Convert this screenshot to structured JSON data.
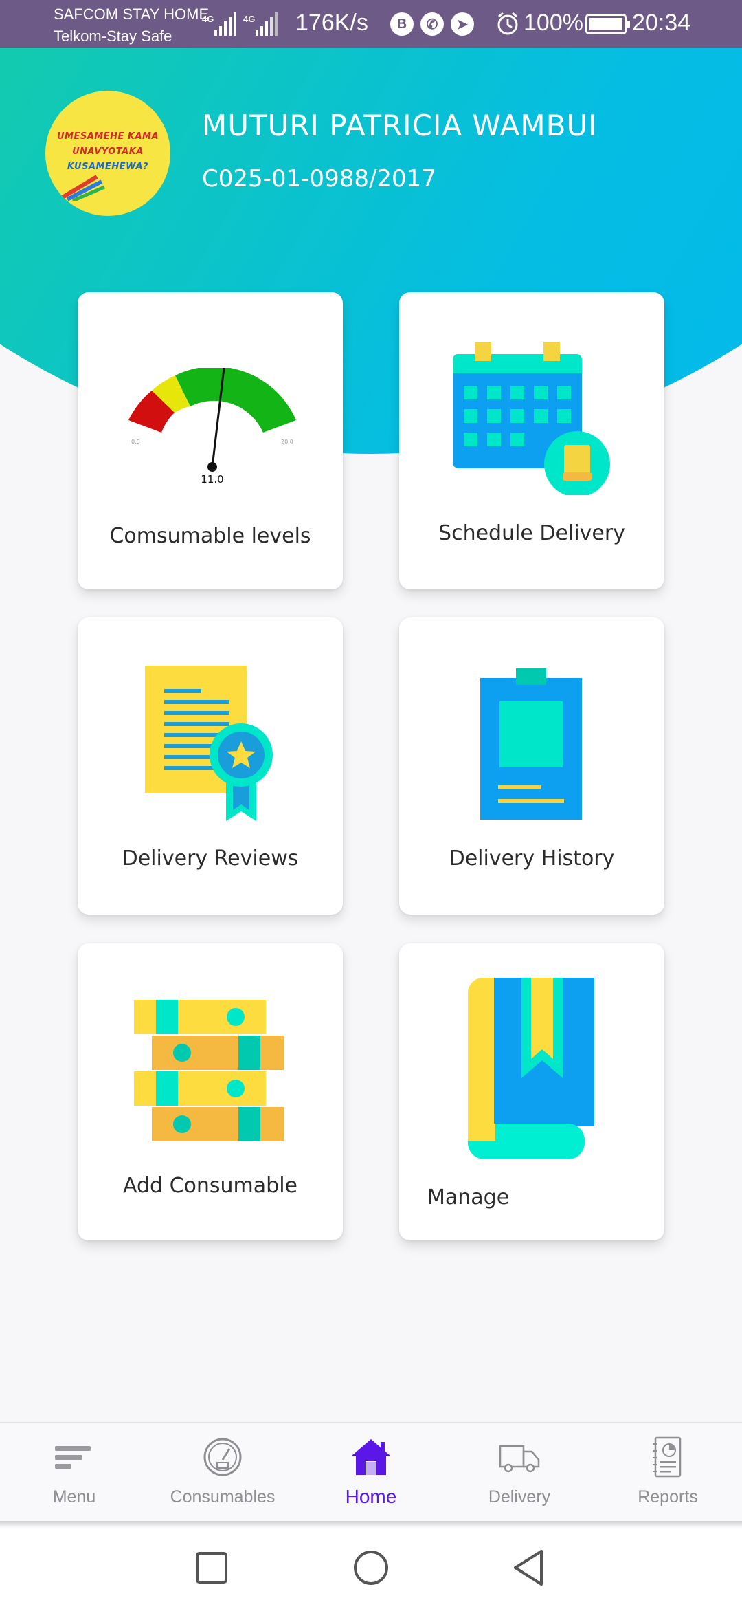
{
  "status_bar": {
    "carrier_1": "SAFCOM STAY HOME",
    "carrier_2": "Telkom-Stay Safe",
    "network_1": "4G",
    "network_2": "4G",
    "speed": "176K/s",
    "notification_icons": [
      "bim-icon",
      "whatsapp-icon",
      "telegram-icon"
    ],
    "battery_pct": "100%",
    "time": "20:34"
  },
  "profile": {
    "name": "MUTURI PATRICIA WAMBUI",
    "id_number": "C025-01-0988/2017",
    "avatar_lines": [
      "UMESAMEHE KAMA",
      "UNAVYOTAKA",
      "KUSAMEHEWA?"
    ]
  },
  "cards": {
    "consumable_levels": {
      "label": "Comsumable levels",
      "gauge_value": "11.0",
      "gauge_min": "0.0",
      "gauge_max": "20.0",
      "gauge_fraction": 0.55
    },
    "schedule_delivery": {
      "label": "Schedule Delivery"
    },
    "delivery_reviews": {
      "label": "Delivery Reviews"
    },
    "delivery_history": {
      "label": "Delivery History"
    },
    "add_consumable": {
      "label": "Add Consumable"
    },
    "manage": {
      "label": "Manage"
    }
  },
  "bottom_nav": {
    "items": [
      {
        "label": "Menu",
        "icon": "menu-icon"
      },
      {
        "label": "Consumables",
        "icon": "gauge-icon"
      },
      {
        "label": "Home",
        "icon": "home-icon",
        "active": true
      },
      {
        "label": "Delivery",
        "icon": "truck-icon"
      },
      {
        "label": "Reports",
        "icon": "report-icon"
      }
    ]
  },
  "colors": {
    "accent": "#5b17e6",
    "status_bar": "#6e5a86",
    "gradient_start": "#1fd67e",
    "gradient_end": "#00b6f2"
  }
}
